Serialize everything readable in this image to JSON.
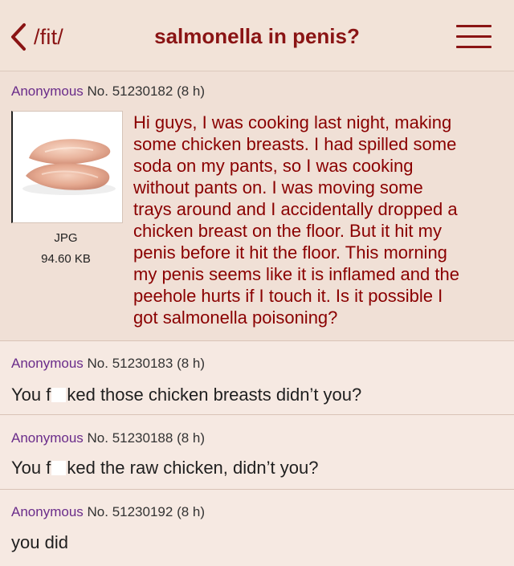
{
  "topbar": {
    "back_label": "/fit/",
    "title": "salmonella in penis?"
  },
  "op": {
    "name": "Anonymous",
    "number": "No. 51230182",
    "age": "(8 h)",
    "file_type": "JPG",
    "file_size": "94.60 KB",
    "lines": [
      "Hi guys, I was cooking last night, making",
      "some chicken breasts. I had spilled some",
      "soda on my pants, so I was cooking",
      "without pants on. I was moving some",
      "trays around and I accidentally dropped a",
      "chicken breast on the floor. But it hit my",
      "penis before it hit the floor. This morning",
      "my penis seems like it is inflamed and the",
      "peehole hurts if I touch it. Is it possible I",
      "got salmonella poisoning?"
    ]
  },
  "replies": [
    {
      "name": "Anonymous",
      "number": "No. 51230183",
      "age": "(8 h)",
      "text_before": "You f",
      "text_after": "ked those chicken breasts didn’t you?"
    },
    {
      "name": "Anonymous",
      "number": "No. 51230188",
      "age": "(8 h)",
      "text_before": "You f",
      "text_after": "ked the raw chicken, didn’t you?"
    },
    {
      "name": "Anonymous",
      "number": "No. 51230192",
      "age": "(8 h)",
      "text_before": "you did",
      "text_after": ""
    }
  ],
  "icons": {
    "back": "chevron-left-icon",
    "menu": "hamburger-menu-icon",
    "thumbnail": "chicken-breast-image"
  },
  "colors": {
    "background": "#f0e0d6",
    "reply_background": "#f6e9e2",
    "accent": "#8a1414",
    "name": "#6a2c8a",
    "op_text": "#8a0000"
  }
}
